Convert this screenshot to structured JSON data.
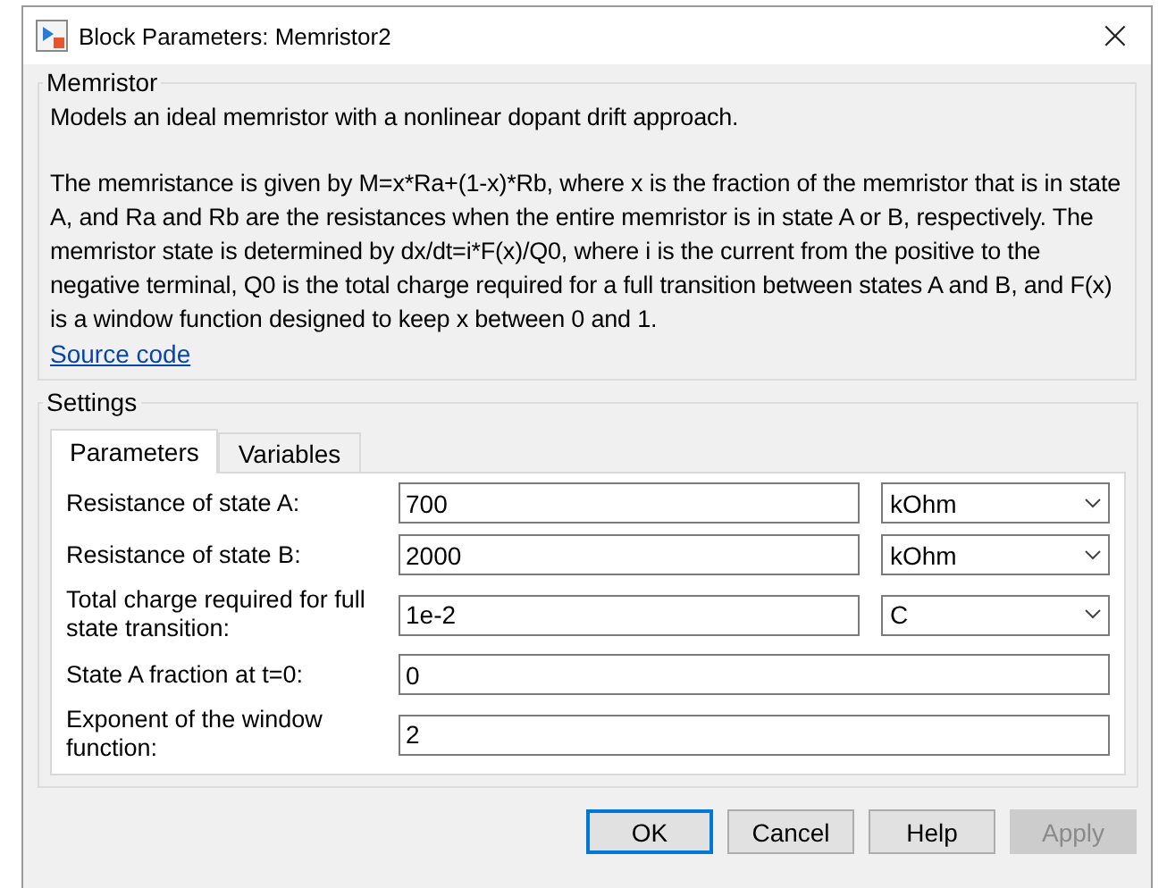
{
  "window": {
    "title": "Block Parameters: Memristor2",
    "close": "×"
  },
  "description": {
    "legend": "Memristor",
    "summary": "Models an ideal memristor with a nonlinear dopant drift approach.",
    "details": "The memristance is given by M=x*Ra+(1-x)*Rb, where x is the fraction of the memristor that is in state A, and Ra and Rb are the resistances when the entire memristor is in state A or B, respectively. The memristor state is determined by dx/dt=i*F(x)/Q0, where i is the current from the positive to the negative terminal, Q0 is the total charge required for a full transition between states A and B, and F(x) is a window function designed to keep x between 0 and 1.",
    "link": "Source code"
  },
  "settings": {
    "legend": "Settings",
    "tabs": [
      {
        "label": "Parameters",
        "selected": true
      },
      {
        "label": "Variables",
        "selected": false
      }
    ],
    "rows": [
      {
        "kind": "unit",
        "label": "Resistance of state A:",
        "value": "700",
        "unit": "kOhm"
      },
      {
        "kind": "unit",
        "label": "Resistance of state B:",
        "value": "2000",
        "unit": "kOhm"
      },
      {
        "kind": "unit",
        "label": "Total charge required for full state transition:",
        "value": "1e-2",
        "unit": "C"
      },
      {
        "kind": "plain",
        "label": "State A fraction at t=0:",
        "value": "0"
      },
      {
        "kind": "plain",
        "label": "Exponent of the window function:",
        "value": "2"
      }
    ]
  },
  "buttons": [
    {
      "label": "OK",
      "default": true,
      "disabled": false
    },
    {
      "label": "Cancel",
      "default": false,
      "disabled": false
    },
    {
      "label": "Help",
      "default": false,
      "disabled": false
    },
    {
      "label": "Apply",
      "default": false,
      "disabled": true
    }
  ]
}
